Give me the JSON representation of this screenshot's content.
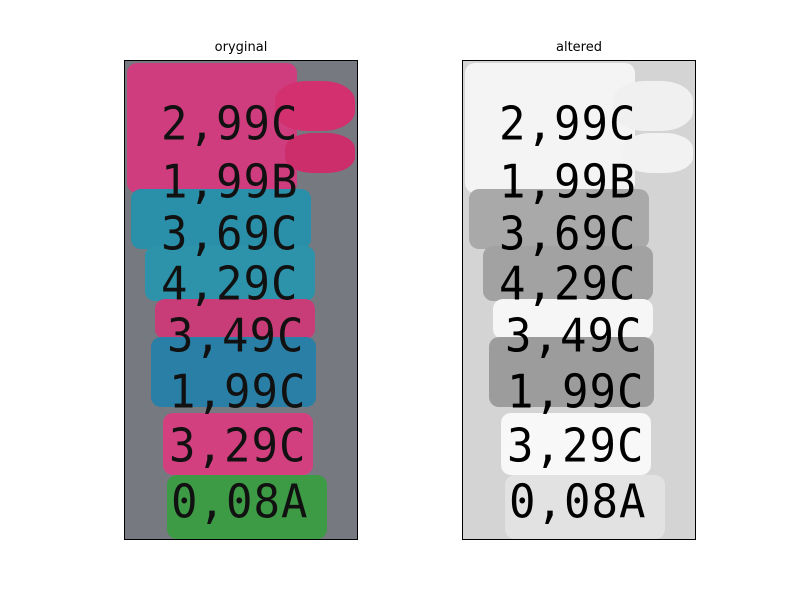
{
  "panels": {
    "left": {
      "title": "oryginal"
    },
    "right": {
      "title": "altered"
    }
  },
  "labels": [
    "2,99C",
    "1,99B",
    "3,69C",
    "4,29C",
    "3,49C",
    "1,99C",
    "3,29C",
    "0,08A"
  ],
  "colors": {
    "pink": "#d6357a",
    "teal": "#2aa0b0",
    "green": "#3ca83c",
    "background_left": "#767a80",
    "background_right": "#d4d4d4"
  }
}
